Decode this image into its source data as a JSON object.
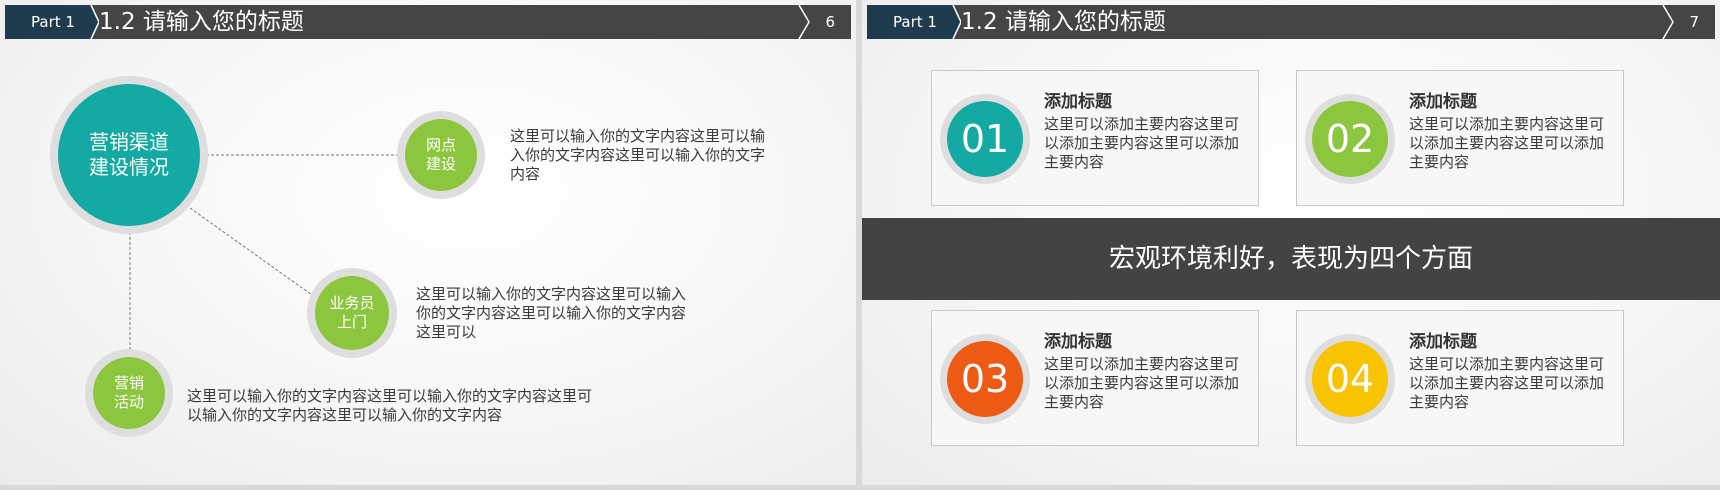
{
  "slide6": {
    "part_label": "Part 1",
    "title": "1.2 请输入您的标题",
    "page_number": "6",
    "main_circle": {
      "line1": "营销渠道",
      "line2": "建设情况"
    },
    "nodes": [
      {
        "line1": "网点",
        "line2": "建设",
        "text": "这里可以输入你的文字内容这里可以输入你的文字内容这里可以输入你的文字内容"
      },
      {
        "line1": "业务员",
        "line2": "上门",
        "text": "这里可以输入你的文字内容这里可以输入你的文字内容这里可以输入你的文字内容这里可以"
      },
      {
        "line1": "营销",
        "line2": "活动",
        "text": "这里可以输入你的文字内容这里可以输入你的文字内容这里可以输入你的文字内容这里可以输入你的文字内容"
      }
    ]
  },
  "slide7": {
    "part_label": "Part 1",
    "title": "1.2 请输入您的标题",
    "page_number": "7",
    "band_text": "宏观环境利好，表现为四个方面",
    "cards": [
      {
        "number": "01",
        "title": "添加标题",
        "text": "这里可以添加主要内容这里可以添加主要内容这里可以添加主要内容"
      },
      {
        "number": "02",
        "title": "添加标题",
        "text": "这里可以添加主要内容这里可以添加主要内容这里可以添加主要内容"
      },
      {
        "number": "03",
        "title": "添加标题",
        "text": "这里可以添加主要内容这里可以添加主要内容这里可以添加主要内容"
      },
      {
        "number": "04",
        "title": "添加标题",
        "text": "这里可以添加主要内容这里可以添加主要内容这里可以添加主要内容"
      }
    ]
  },
  "colors": {
    "teal": "#14a9a2",
    "green": "#8cc63f",
    "orange": "#ec5a14",
    "yellow": "#f8c300",
    "header": "#454545",
    "part_tab": "#1f3c4f"
  }
}
